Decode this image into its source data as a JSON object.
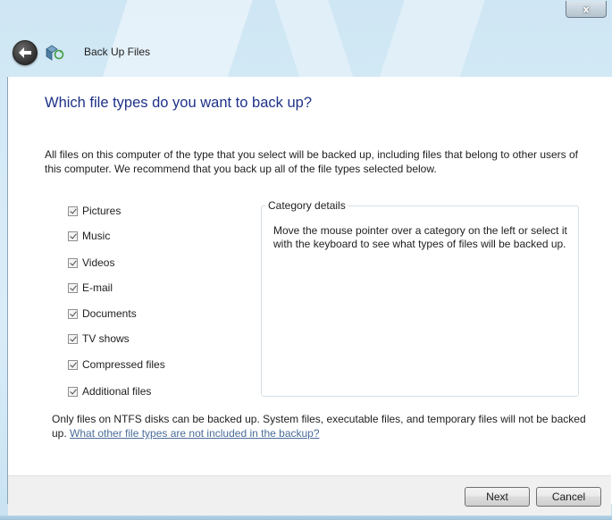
{
  "window": {
    "title": "Back Up Files",
    "close_label": "x"
  },
  "page": {
    "heading": "Which file types do you want to back up?",
    "intro": "All files on this computer of the type that you select will be backed up, including files that belong to other users of this computer. We recommend that you back up all of the file types selected below."
  },
  "file_types": [
    {
      "label": "Pictures",
      "checked": true
    },
    {
      "label": "Music",
      "checked": true
    },
    {
      "label": "Videos",
      "checked": true
    },
    {
      "label": "E-mail",
      "checked": true
    },
    {
      "label": "Documents",
      "checked": true
    },
    {
      "label": "TV shows",
      "checked": true
    },
    {
      "label": "Compressed files",
      "checked": true
    },
    {
      "label": "Additional files",
      "checked": true
    }
  ],
  "details": {
    "legend": "Category details",
    "text": "Move the mouse pointer over a category on the left or select it with the keyboard to see what types of files will be backed up."
  },
  "note": {
    "text": "Only files on NTFS disks can be backed up. System files, executable files, and temporary files will not be backed up. ",
    "link": "What other file types are not included in the backup?"
  },
  "buttons": {
    "next": "Next",
    "cancel": "Cancel"
  },
  "icons": {
    "back": "back-arrow-icon",
    "app": "backup-app-icon",
    "close": "close-icon"
  }
}
